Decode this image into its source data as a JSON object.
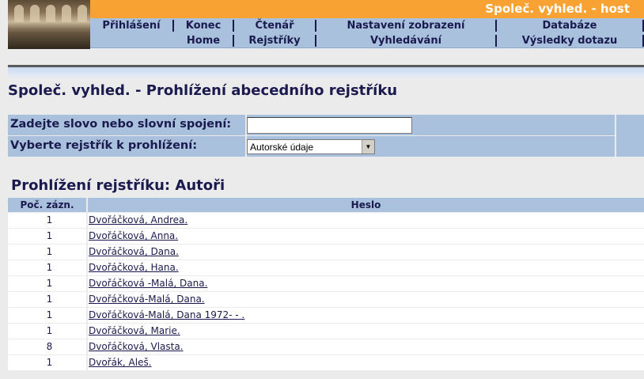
{
  "header": {
    "banner_title": "Společ. vyhled. - host",
    "nav_row1": [
      "Přihlášení",
      "Konec",
      "Čtenář",
      "Nastavení zobrazení",
      "Databáze"
    ],
    "nav_row2": [
      "",
      "Home",
      "Rejstříky",
      "Vyhledávání",
      "Výsledky dotazu"
    ]
  },
  "page_title": "Společ. vyhled. - Prohlížení abecedního rejstříku",
  "form": {
    "word_label": "Zadejte slovo nebo slovní spojení:",
    "word_value": "",
    "index_label": "Vyberte rejstřík k prohlížení:",
    "index_selected": "Autorské údaje"
  },
  "section_title": "Prohlížení rejstříku: Autoři",
  "table": {
    "col_count": "Poč. zázn.",
    "col_heading": "Heslo",
    "rows": [
      {
        "count": "1",
        "heading": "Dvořáčková, Andrea."
      },
      {
        "count": "1",
        "heading": "Dvořáčková, Anna."
      },
      {
        "count": "1",
        "heading": "Dvořáčková, Dana."
      },
      {
        "count": "1",
        "heading": "Dvořáčková, Hana."
      },
      {
        "count": "1",
        "heading": "Dvořáčková -Malá, Dana."
      },
      {
        "count": "1",
        "heading": "Dvořáčková-Malá, Dana."
      },
      {
        "count": "1",
        "heading": "Dvořáčková-Malá, Dana 1972- - ."
      },
      {
        "count": "1",
        "heading": "Dvořáčková, Marie."
      },
      {
        "count": "8",
        "heading": "Dvořáčková, Vlasta."
      },
      {
        "count": "1",
        "heading": "Dvořák, Aleš."
      }
    ]
  },
  "colors": {
    "banner": "#f7a233",
    "nav": "#a9c1dd",
    "text": "#1a1a4e"
  }
}
